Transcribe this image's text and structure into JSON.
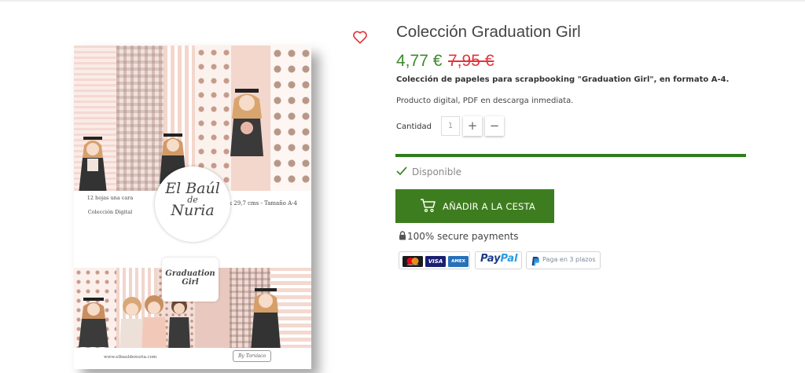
{
  "product": {
    "title": "Colección Graduation Girl",
    "price": "4,77 €",
    "old_price": "7,95 €",
    "short_description": "Colección de papeles para scrapbooking \"Graduation Girl\", en formato A-4.",
    "digital_note": "Producto digital, PDF en descarga inmediata.",
    "availability": "Disponible"
  },
  "image": {
    "band_left": [
      "12 hojas una cara",
      "Colección Digital"
    ],
    "band_right": "21 x 29,7 cms - Tamaño A-4",
    "logo": [
      "El Baúl",
      "de",
      "Nuria"
    ],
    "badge": [
      "Graduation",
      "Girl"
    ],
    "site_url": "www.elbauldenuria.com",
    "footer_logo": "By Torvisco"
  },
  "quantity": {
    "label": "Cantidad",
    "value": "1",
    "increment": "+",
    "decrement": "−"
  },
  "cart": {
    "add_label": "AÑADIR A LA CESTA",
    "progress": 1.0
  },
  "payments": {
    "secure_text": "100% secure payments",
    "cards": [
      "mastercard",
      "VISA",
      "AMEX"
    ],
    "paypal": [
      "Pay",
      "Pal"
    ],
    "installments": "Paga en 3 plazos"
  },
  "colors": {
    "price": "#3c8a2e",
    "old_price": "#e0353c",
    "button": "#3e7d1f",
    "progress": "#2e7d1a",
    "wishlist": "#e0353c"
  },
  "icons": [
    "heart-outline-icon",
    "check-icon",
    "cart-icon",
    "lock-icon",
    "mastercard-logo",
    "visa-logo",
    "amex-logo",
    "paypal-logo"
  ]
}
